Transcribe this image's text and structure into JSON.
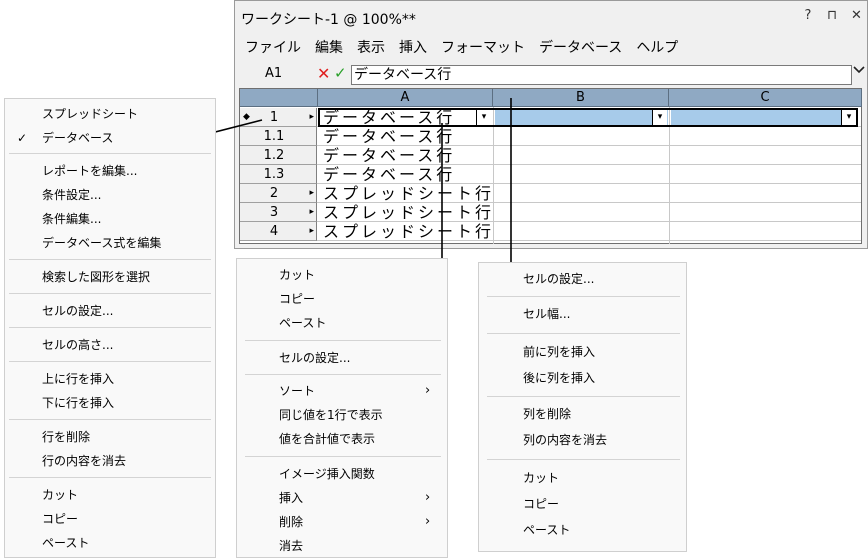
{
  "window": {
    "title": "ワークシート-1 @ 100%**",
    "controls": [
      "?",
      "⊓",
      "✕"
    ],
    "menubar": [
      "ファイル",
      "編集",
      "表示",
      "挿入",
      "フォーマット",
      "データベース",
      "ヘルプ"
    ]
  },
  "formula_bar": {
    "cell_ref": "A1",
    "cancel": "✕",
    "accept": "✓",
    "value": "データベース行"
  },
  "grid": {
    "columns": [
      "A",
      "B",
      "C"
    ],
    "rows": [
      {
        "label": "1",
        "text": "データベース行",
        "db_header": true,
        "selected": true
      },
      {
        "label": "1.1",
        "text": "データベース行",
        "db_header": false,
        "selected": false
      },
      {
        "label": "1.2",
        "text": "データベース行",
        "db_header": false,
        "selected": false
      },
      {
        "label": "1.3",
        "text": "データベース行",
        "db_header": false,
        "selected": false
      },
      {
        "label": "2",
        "text": "スプレッドシート行",
        "db_header": true,
        "selected": false
      },
      {
        "label": "3",
        "text": "スプレッドシート行",
        "db_header": true,
        "selected": false
      },
      {
        "label": "4",
        "text": "スプレッドシート行",
        "db_header": true,
        "selected": false
      }
    ]
  },
  "menu_row_header": {
    "groups": [
      [
        {
          "label": "スプレッドシート",
          "checked": false
        },
        {
          "label": "データベース",
          "checked": true
        }
      ],
      [
        {
          "label": "レポートを編集..."
        },
        {
          "label": "条件設定..."
        },
        {
          "label": "条件編集..."
        },
        {
          "label": "データベース式を編集"
        }
      ],
      [
        {
          "label": "検索した図形を選択"
        }
      ],
      [
        {
          "label": "セルの設定..."
        }
      ],
      [
        {
          "label": "セルの高さ..."
        }
      ],
      [
        {
          "label": "上に行を挿入"
        },
        {
          "label": "下に行を挿入"
        }
      ],
      [
        {
          "label": "行を削除"
        },
        {
          "label": "行の内容を消去"
        }
      ],
      [
        {
          "label": "カット"
        },
        {
          "label": "コピー"
        },
        {
          "label": "ペースト"
        }
      ]
    ]
  },
  "menu_cell": {
    "groups": [
      [
        {
          "label": "カット"
        },
        {
          "label": "コピー"
        },
        {
          "label": "ペースト"
        }
      ],
      [
        {
          "label": "セルの設定..."
        }
      ],
      [
        {
          "label": "ソート",
          "submenu": true
        },
        {
          "label": "同じ値を1行で表示"
        },
        {
          "label": "値を合計値で表示"
        }
      ],
      [
        {
          "label": "イメージ挿入関数"
        },
        {
          "label": "挿入",
          "submenu": true
        },
        {
          "label": "削除",
          "submenu": true
        },
        {
          "label": "消去"
        }
      ]
    ]
  },
  "menu_column_header": {
    "groups": [
      [
        {
          "label": "セルの設定..."
        }
      ],
      [
        {
          "label": "セル幅..."
        }
      ],
      [
        {
          "label": "前に列を挿入"
        },
        {
          "label": "後に列を挿入"
        }
      ],
      [
        {
          "label": "列を削除"
        },
        {
          "label": "列の内容を消去"
        }
      ],
      [
        {
          "label": "カット"
        },
        {
          "label": "コピー"
        },
        {
          "label": "ペースト"
        }
      ]
    ]
  },
  "icons": {
    "checkmark": "✓",
    "submenu_arrow": "›",
    "dropdown": "▾",
    "row_arrow": "▸",
    "db_marker": "◆"
  }
}
